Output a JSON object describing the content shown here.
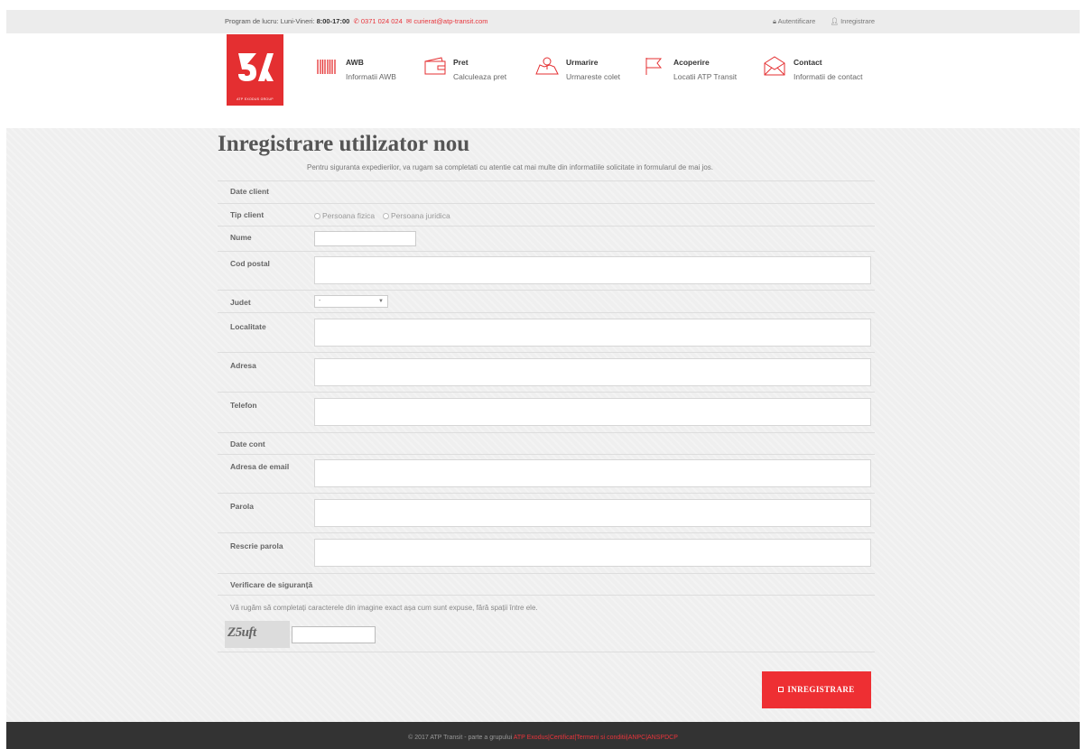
{
  "topbar": {
    "hours_label": "Program de lucru: Luni-Vineri:",
    "hours_value": "8:00-17:00",
    "phone": "0371 024 024",
    "email": "curierat@atp-transit.com",
    "login": "Autentificare",
    "register": "Inregistrare"
  },
  "logo": {
    "tagline": "ATP EXODUS GROUP"
  },
  "nav": [
    {
      "title": "AWB",
      "sub": "Informatii AWB",
      "icon": "barcode-icon"
    },
    {
      "title": "Pret",
      "sub": "Calculeaza pret",
      "icon": "wallet-icon"
    },
    {
      "title": "Urmarire",
      "sub": "Urmareste colet",
      "icon": "map-pin-icon"
    },
    {
      "title": "Acoperire",
      "sub": "Locatii ATP Transit",
      "icon": "flag-icon"
    },
    {
      "title": "Contact",
      "sub": "Informatii de contact",
      "icon": "envelope-icon"
    }
  ],
  "page": {
    "title": "Inregistrare utilizator nou",
    "intro": "Pentru siguranta expedierilor, va rugam sa completati cu atentie cat mai multe din informatiile solicitate in formularul de mai jos."
  },
  "form": {
    "section_client": "Date client",
    "tip_client": "Tip client",
    "radio_pf": "Persoana fizica",
    "radio_pj": "Persoana juridica",
    "nume": "Nume",
    "cod_postal": "Cod postal",
    "judet": "Judet",
    "judet_value": "-",
    "localitate": "Localitate",
    "adresa": "Adresa",
    "telefon": "Telefon",
    "section_cont": "Date cont",
    "email": "Adresa de email",
    "parola": "Parola",
    "rescrie": "Rescrie parola",
    "verificare": "Verificare de siguranță",
    "verificare_note": "Vă rugăm să completați caracterele din imagine exact așa cum sunt expuse, fără spații între ele.",
    "captcha_text": "Z5uft",
    "submit": "INREGISTRARE"
  },
  "footer": {
    "text": "© 2017 ATP Transit - parte a grupului",
    "link1": "ATP Exodus",
    "sep": "|",
    "link2": "Certificat",
    "link3": "Termeni si conditii",
    "link4": "ANPC",
    "link5": "ANSPDCP"
  },
  "colors": {
    "accent": "#e42f31",
    "footer_bg": "#333333",
    "body_bg": "#efefef"
  }
}
